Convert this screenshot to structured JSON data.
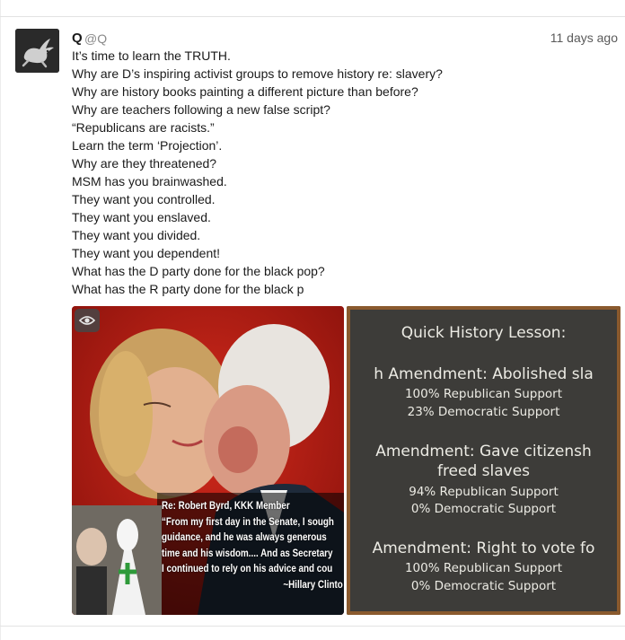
{
  "post": {
    "display_name": "Q",
    "handle": "@Q",
    "timestamp": "11 days ago",
    "lines": [
      "It’s time to learn the TRUTH.",
      "Why are D’s inspiring activist groups to remove history re: slavery?",
      "Why are history books painting a different picture than before?",
      "Why are teachers following a new false script?",
      "“Republicans are racists.”",
      "Learn the term ‘Projection’.",
      "Why are they threatened?",
      "MSM has you brainwashed.",
      "They want you controlled.",
      "They want you enslaved.",
      "They want you divided.",
      "They want you dependent!",
      "What has the D party done for the black pop?",
      "What has the R party done for the black p"
    ]
  },
  "media_1": {
    "caption_lines": [
      "Re: Robert Byrd, KKK Member",
      "“From my first day in the Senate, I sough",
      "guidance, and he was always generous",
      "time and his wisdom.... And as Secretary",
      "I continued to rely on his advice and cou"
    ],
    "signature": "~Hillary Clinto"
  },
  "media_2": {
    "title": "Quick History Lesson:",
    "sections": [
      {
        "heading": "h Amendment: Abolished sla",
        "heading2": "",
        "rep": "100% Republican Support",
        "dem": "23% Democratic Support"
      },
      {
        "heading": "Amendment: Gave citizensh",
        "heading2": "freed slaves",
        "rep": "94% Republican Support",
        "dem": "0% Democratic Support"
      },
      {
        "heading": "Amendment: Right to vote fo",
        "heading2": "",
        "rep": "100% Republican Support",
        "dem": "0% Democratic Support"
      }
    ]
  },
  "icons": {
    "avatar": "rabbit-logo",
    "sensitive": "eye-icon"
  },
  "colors": {
    "text": "#1a1a1a",
    "muted": "#8a8a8a",
    "chalkboard": "#3b3a37",
    "chalk": "#ecebe4",
    "photo_red": "#b41a12"
  }
}
